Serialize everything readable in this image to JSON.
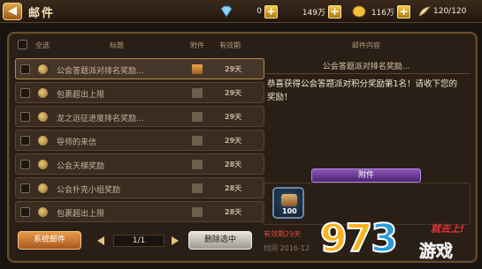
{
  "header": {
    "back_label": "◀",
    "title": "邮件",
    "resources": [
      {
        "icon": "diamond-icon",
        "value": "0"
      },
      {
        "icon": "gold-coin-icon",
        "value": "149万"
      },
      {
        "icon": "coin-icon",
        "value": "116万"
      },
      {
        "icon": "stamina-icon",
        "value": "120/120"
      }
    ],
    "plus_label": "+"
  },
  "list": {
    "col_select_all": "全选",
    "col_subject": "标题",
    "col_attachment": "附件",
    "col_expiry": "有效期",
    "rows": [
      {
        "subject": "公会答题派对排名奖励...",
        "attachment": "gift-icon",
        "days": "29天",
        "selected": true
      },
      {
        "subject": "包裹超出上限",
        "attachment": "box-icon",
        "days": "29天",
        "selected": false
      },
      {
        "subject": "龙之远征进度排名奖励...",
        "attachment": "box-icon",
        "days": "29天",
        "selected": false
      },
      {
        "subject": "导师的来信",
        "attachment": "box-icon",
        "days": "29天",
        "selected": false
      },
      {
        "subject": "公会天梯奖励",
        "attachment": "box-icon",
        "days": "28天",
        "selected": false
      },
      {
        "subject": "公会扑克小组奖励",
        "attachment": "box-icon",
        "days": "28天",
        "selected": false
      },
      {
        "subject": "包裹超出上限",
        "attachment": "box-icon",
        "days": "28天",
        "selected": false
      }
    ]
  },
  "controls": {
    "system_mail": "系统邮件",
    "page": "1/1",
    "delete_selected": "删除选中"
  },
  "detail": {
    "panel_title": "邮件内容",
    "subject": "公会答题派对排名奖励...",
    "body": "恭喜获得公会答题派对积分奖励第1名！请收下您的奖励！",
    "attachment_label": "附件",
    "item_qty": "100",
    "valid": "有效期29天",
    "time": "时间 2016-12"
  },
  "watermark": {
    "digits_a": "9",
    "digits_b": "7",
    "digits_c": "3",
    "slogan": "就去上!",
    "game": "游戏"
  }
}
